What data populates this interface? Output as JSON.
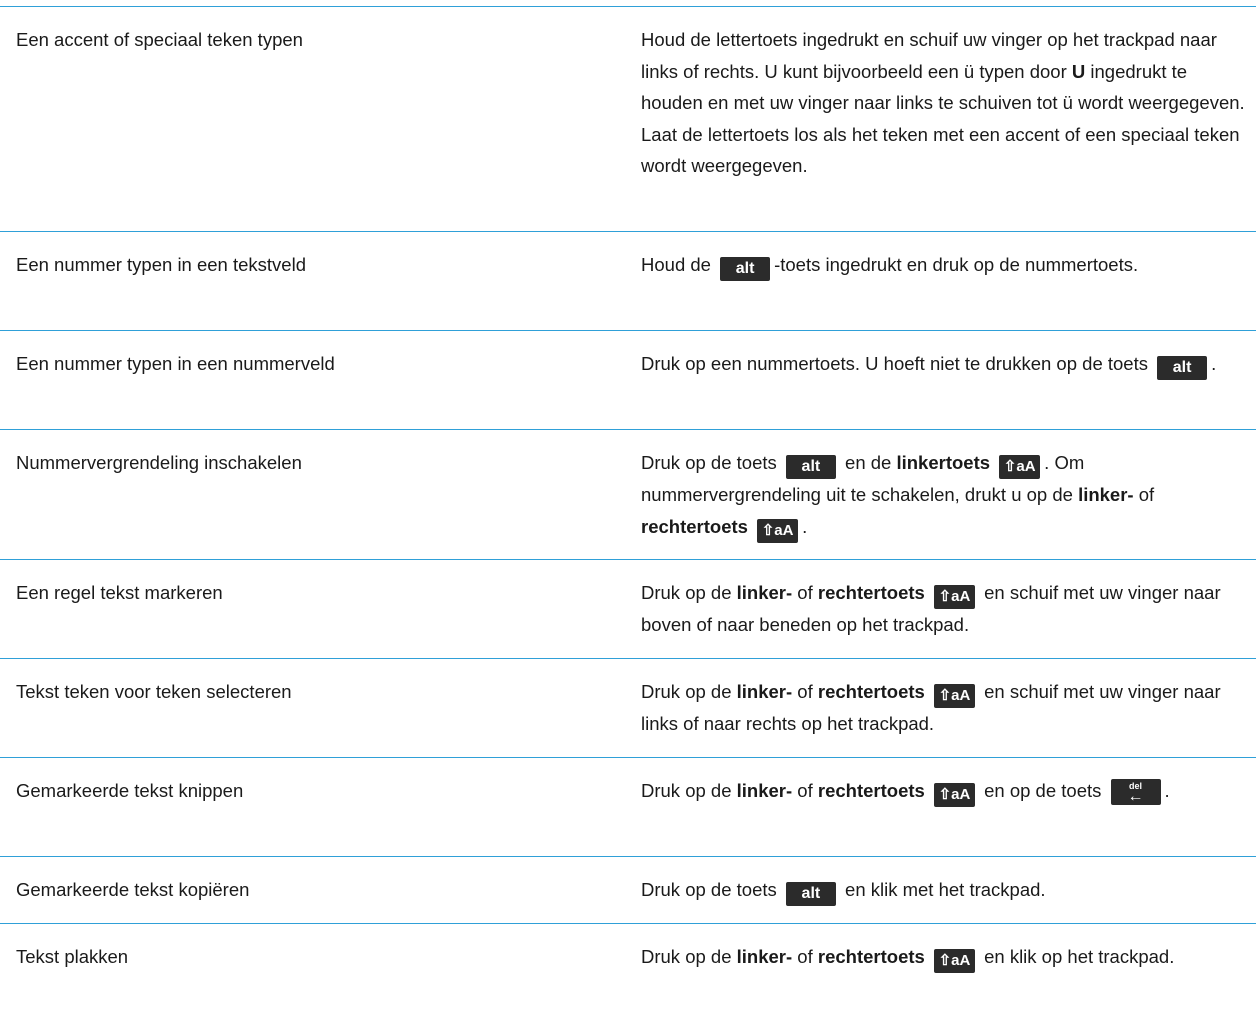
{
  "colors": {
    "rule": "#2fa0d8",
    "key_bg": "#2b2b2b",
    "key_fg": "#ffffff",
    "text": "#1a1a1a"
  },
  "keys": {
    "alt": "alt",
    "shift": "⇧aA",
    "del_label": "del",
    "del_arrow": "←"
  },
  "rows": [
    {
      "action": "Een accent of speciaal teken typen",
      "desc_a": "Houd de lettertoets ingedrukt en schuif uw vinger op het trackpad naar links of rechts. U kunt bijvoorbeeld een ü typen door ",
      "desc_bold": "U",
      "desc_b": " ingedrukt te houden en met uw vinger naar links te schuiven tot ü wordt weergegeven. Laat de lettertoets los als het teken met een accent of een speciaal teken wordt weergegeven."
    },
    {
      "action": "Een nummer typen in een tekstveld",
      "desc_a": "Houd de ",
      "desc_b": "-toets ingedrukt en druk op de nummertoets."
    },
    {
      "action": "Een nummer typen in een nummerveld",
      "desc_a": "Druk op een nummertoets. U hoeft niet te drukken op de toets ",
      "desc_b": "."
    },
    {
      "action": "Nummervergrendeling inschakelen",
      "desc_a": "Druk op de toets ",
      "desc_b": " en de ",
      "desc_bold1": "linkertoets",
      "desc_c": ". Om nummervergrendeling uit te schakelen, drukt u op de ",
      "desc_bold2": "linker-",
      "desc_d": " of ",
      "desc_bold3": "rechtertoets",
      "desc_e": "."
    },
    {
      "action": "Een regel tekst markeren",
      "desc_a": "Druk op de ",
      "desc_bold1": "linker-",
      "desc_b": " of ",
      "desc_bold2": "rechtertoets",
      "desc_c": " en schuif met uw vinger naar boven of naar beneden op het trackpad."
    },
    {
      "action": "Tekst teken voor teken selecteren",
      "desc_a": "Druk op de ",
      "desc_bold1": "linker-",
      "desc_b": " of ",
      "desc_bold2": "rechtertoets",
      "desc_c": " en schuif met uw vinger naar links of naar rechts op het trackpad."
    },
    {
      "action": "Gemarkeerde tekst knippen",
      "desc_a": "Druk op de ",
      "desc_bold1": "linker-",
      "desc_b": " of ",
      "desc_bold2": "rechtertoets",
      "desc_c": " en op de toets ",
      "desc_d": "."
    },
    {
      "action": "Gemarkeerde tekst kopiëren",
      "desc_a": "Druk op de toets ",
      "desc_b": " en klik met het trackpad."
    },
    {
      "action": "Tekst plakken",
      "desc_a": "Druk op de ",
      "desc_bold1": "linker-",
      "desc_b": " of ",
      "desc_bold2": "rechtertoets",
      "desc_c": " en klik op het trackpad."
    }
  ]
}
